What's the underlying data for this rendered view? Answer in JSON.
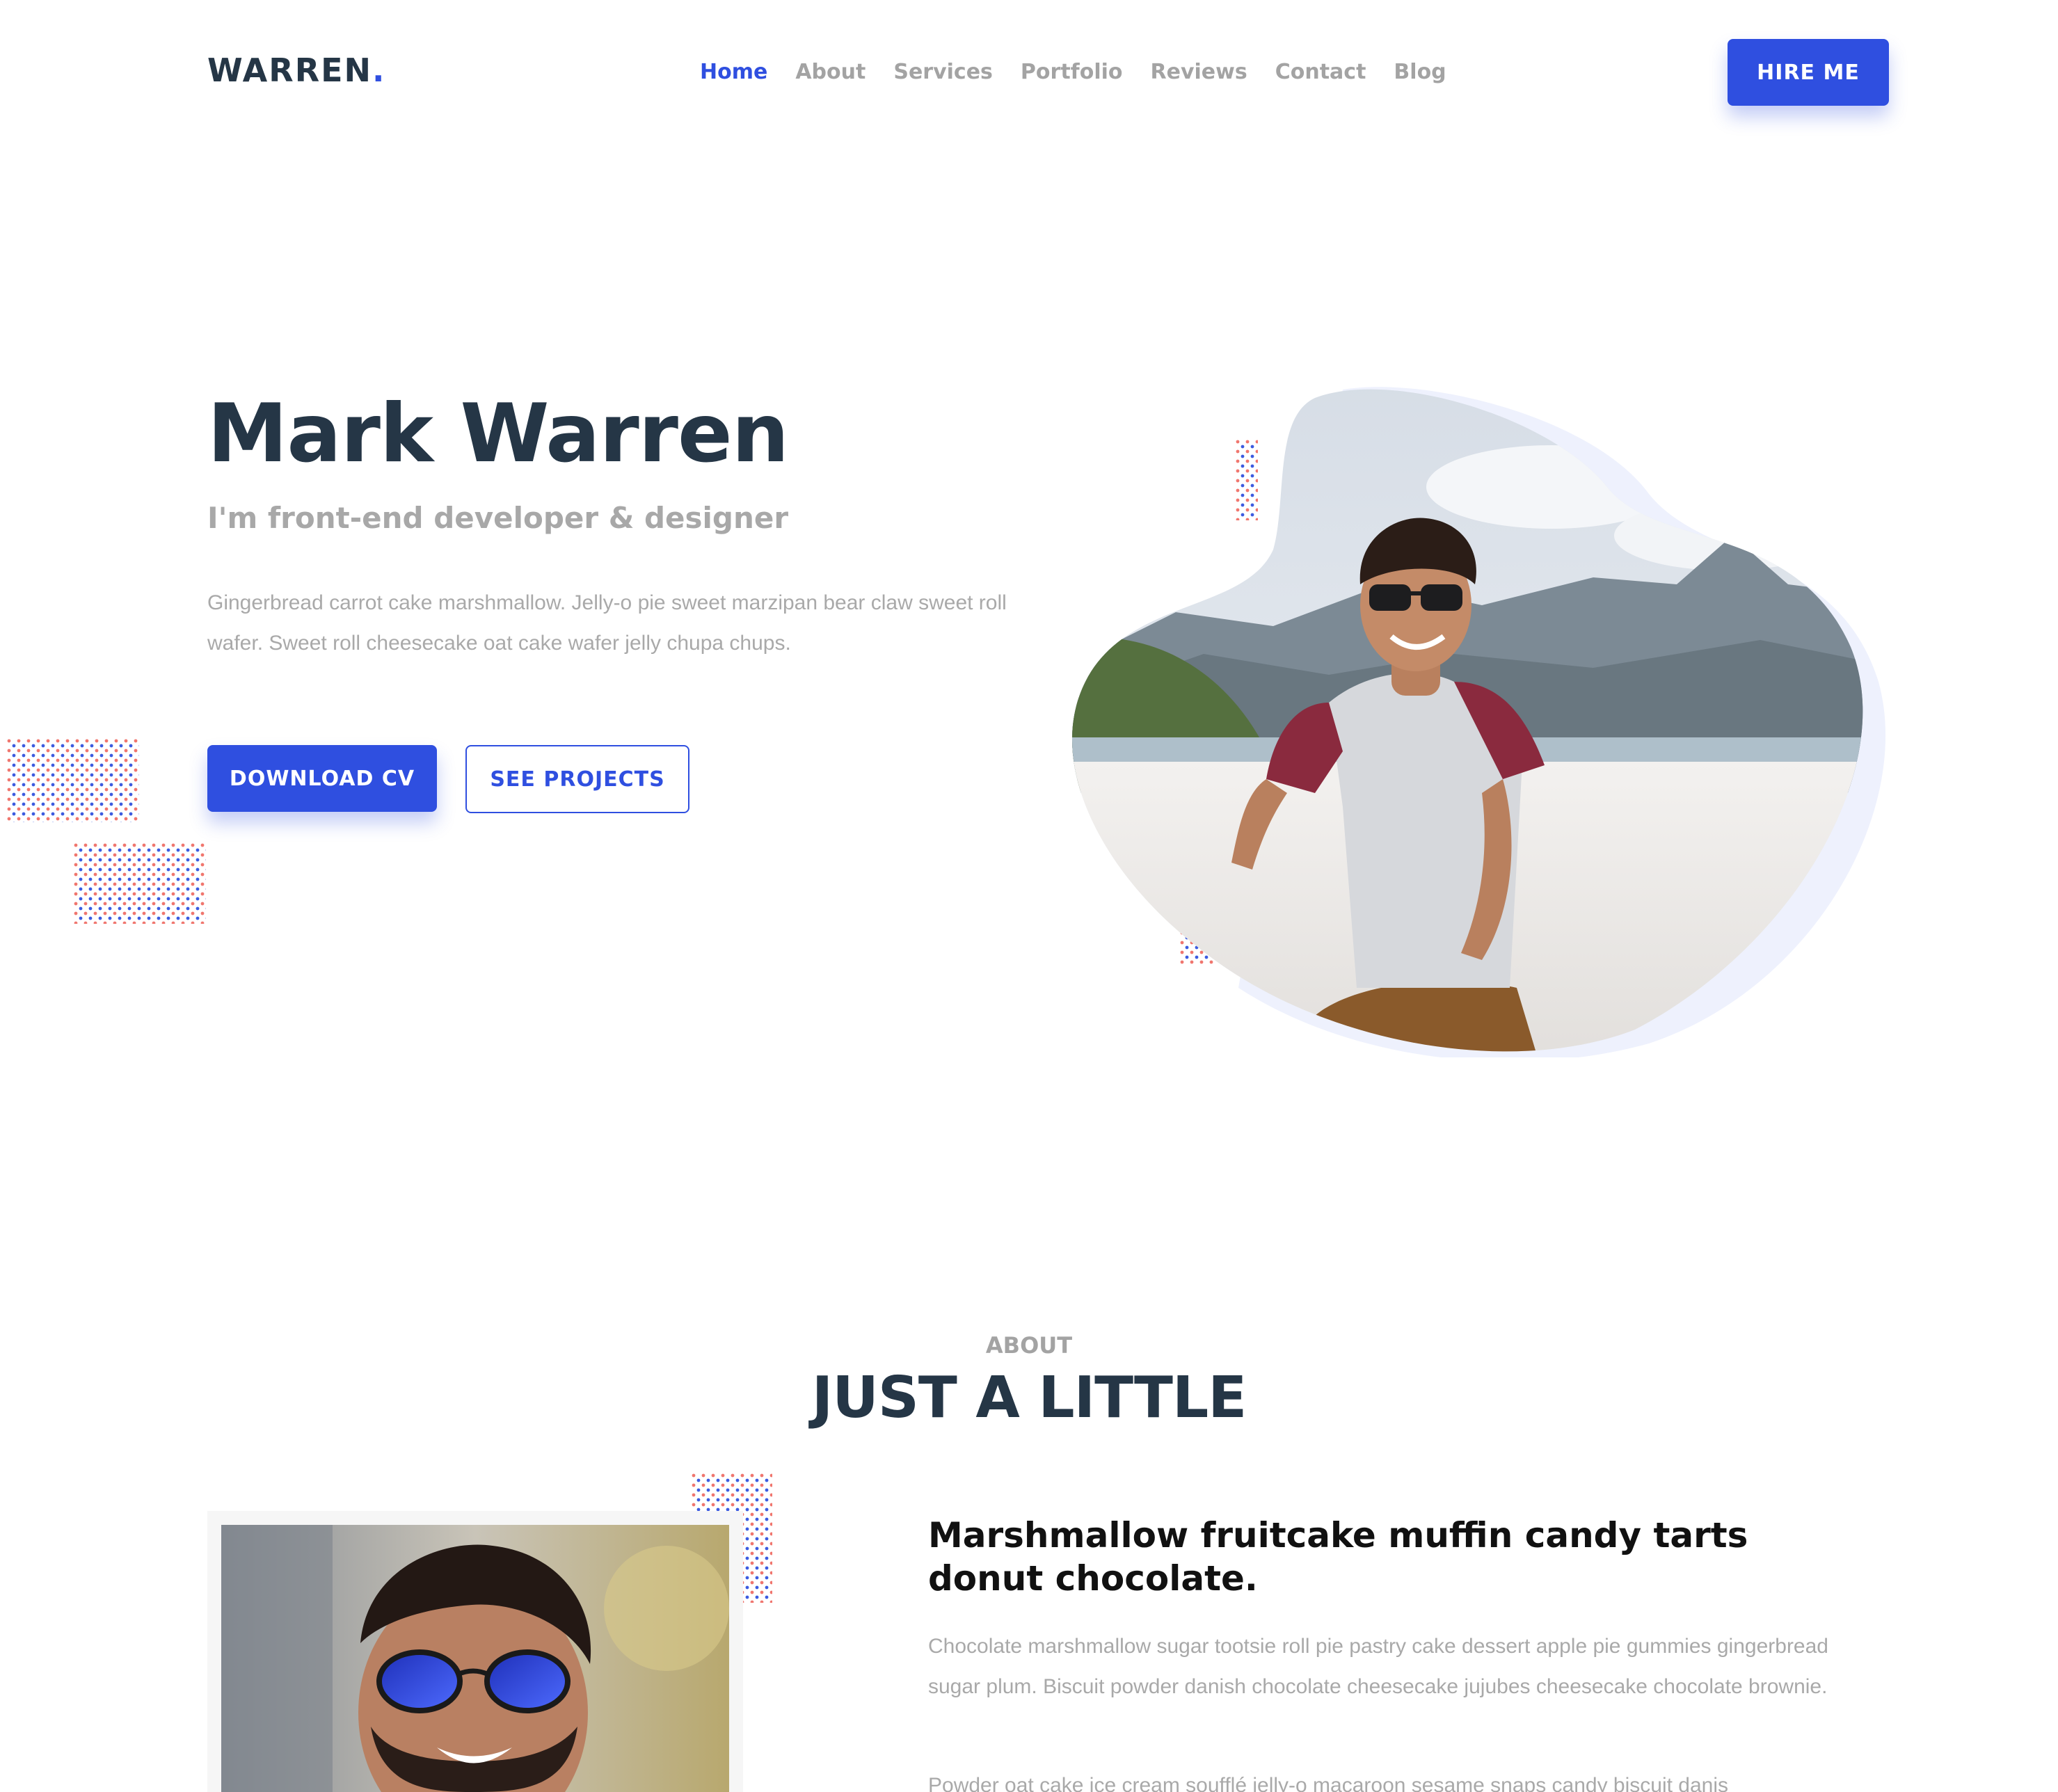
{
  "brand": {
    "name": "WARREN",
    "dot": ".",
    "accent": "#2f4fe0",
    "dark": "#253646"
  },
  "nav": {
    "items": [
      {
        "label": "Home"
      },
      {
        "label": "About"
      },
      {
        "label": "Services"
      },
      {
        "label": "Portfolio"
      },
      {
        "label": "Reviews"
      },
      {
        "label": "Contact"
      },
      {
        "label": "Blog"
      }
    ],
    "active": "Home"
  },
  "header": {
    "hire_label": "HIRE ME"
  },
  "hero": {
    "name": "Mark Warren",
    "role": "I'm front-end developer & designer",
    "description": "Gingerbread carrot cake marshmallow. Jelly-o pie sweet marzipan bear claw sweet roll wafer. Sweet roll cheesecake oat cake wafer jelly chupa chups.",
    "download_label": "DOWNLOAD CV",
    "projects_label": "SEE PROJECTS"
  },
  "about": {
    "eyebrow": "ABOUT",
    "title": "JUST A LITTLE",
    "heading": "Marshmallow fruitcake muffin candy tarts donut chocolate.",
    "paragraph1": "Chocolate marshmallow sugar tootsie roll pie pastry cake dessert apple pie gummies gingerbread sugar plum. Biscuit powder danish chocolate cheesecake jujubes cheesecake chocolate brownie.",
    "paragraph2": "Powder oat cake ice cream soufflé jelly-o macaroon sesame snaps candy biscuit danis"
  },
  "colors": {
    "dot_red": "#f0766e",
    "dot_blue": "#3c5be0",
    "muted_text": "#a9a9a9"
  }
}
